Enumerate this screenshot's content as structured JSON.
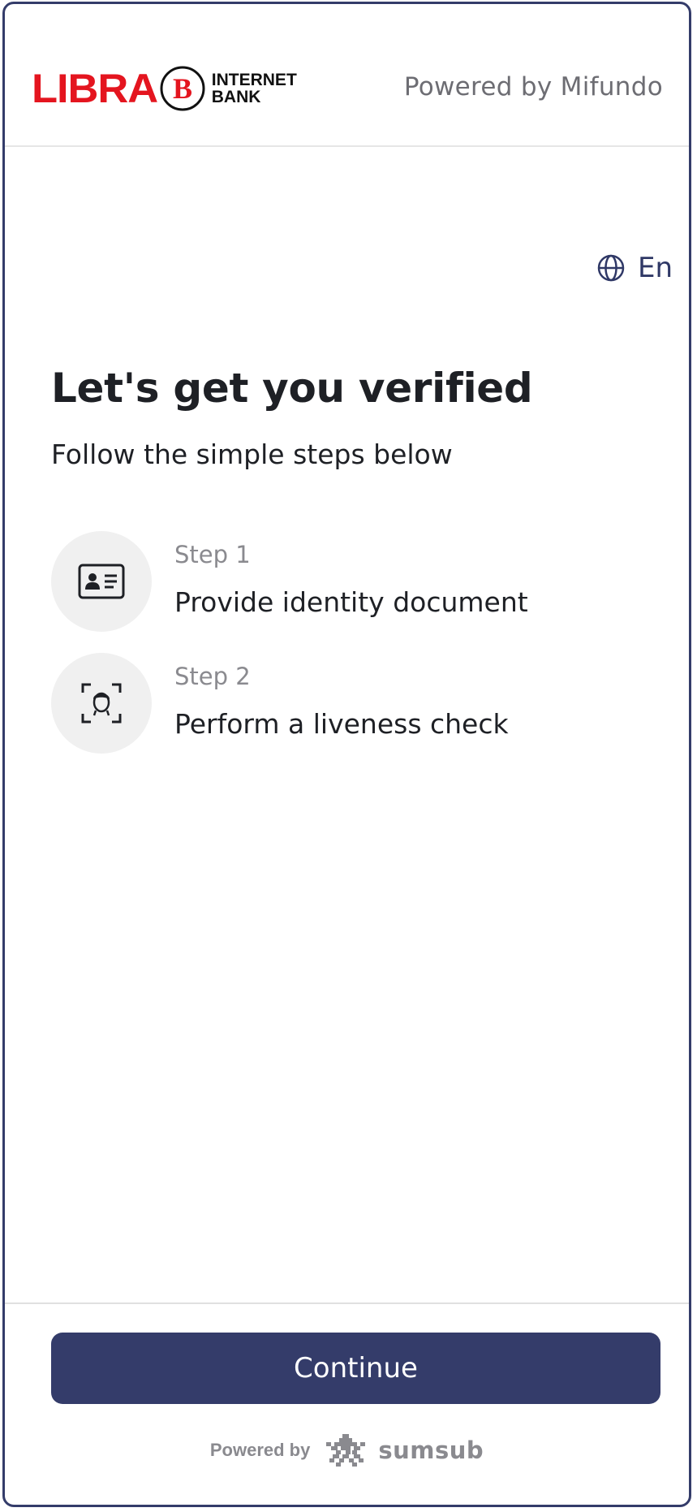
{
  "header": {
    "logo_word": "LIBRA",
    "logo_emblem_letter": "B",
    "logo_tag_line1": "INTERNET",
    "logo_tag_line2": "BANK",
    "powered_by": "Powered by Mifundo"
  },
  "language": {
    "icon": "globe-icon",
    "label": "En"
  },
  "main": {
    "title": "Let's get you verified",
    "subtitle": "Follow the simple steps below",
    "steps": [
      {
        "number": "Step 1",
        "description": "Provide identity document",
        "icon": "id-card-icon"
      },
      {
        "number": "Step 2",
        "description": "Perform a liveness check",
        "icon": "face-scan-icon"
      }
    ]
  },
  "footer": {
    "continue_label": "Continue",
    "powered_by": "Powered by",
    "brand_name": "sumsub",
    "brand_icon": "sumsub-logo-icon"
  },
  "colors": {
    "primary": "#343c6a",
    "logo_red": "#e4151f",
    "text": "#1e2025",
    "muted": "#8a8a8f"
  }
}
